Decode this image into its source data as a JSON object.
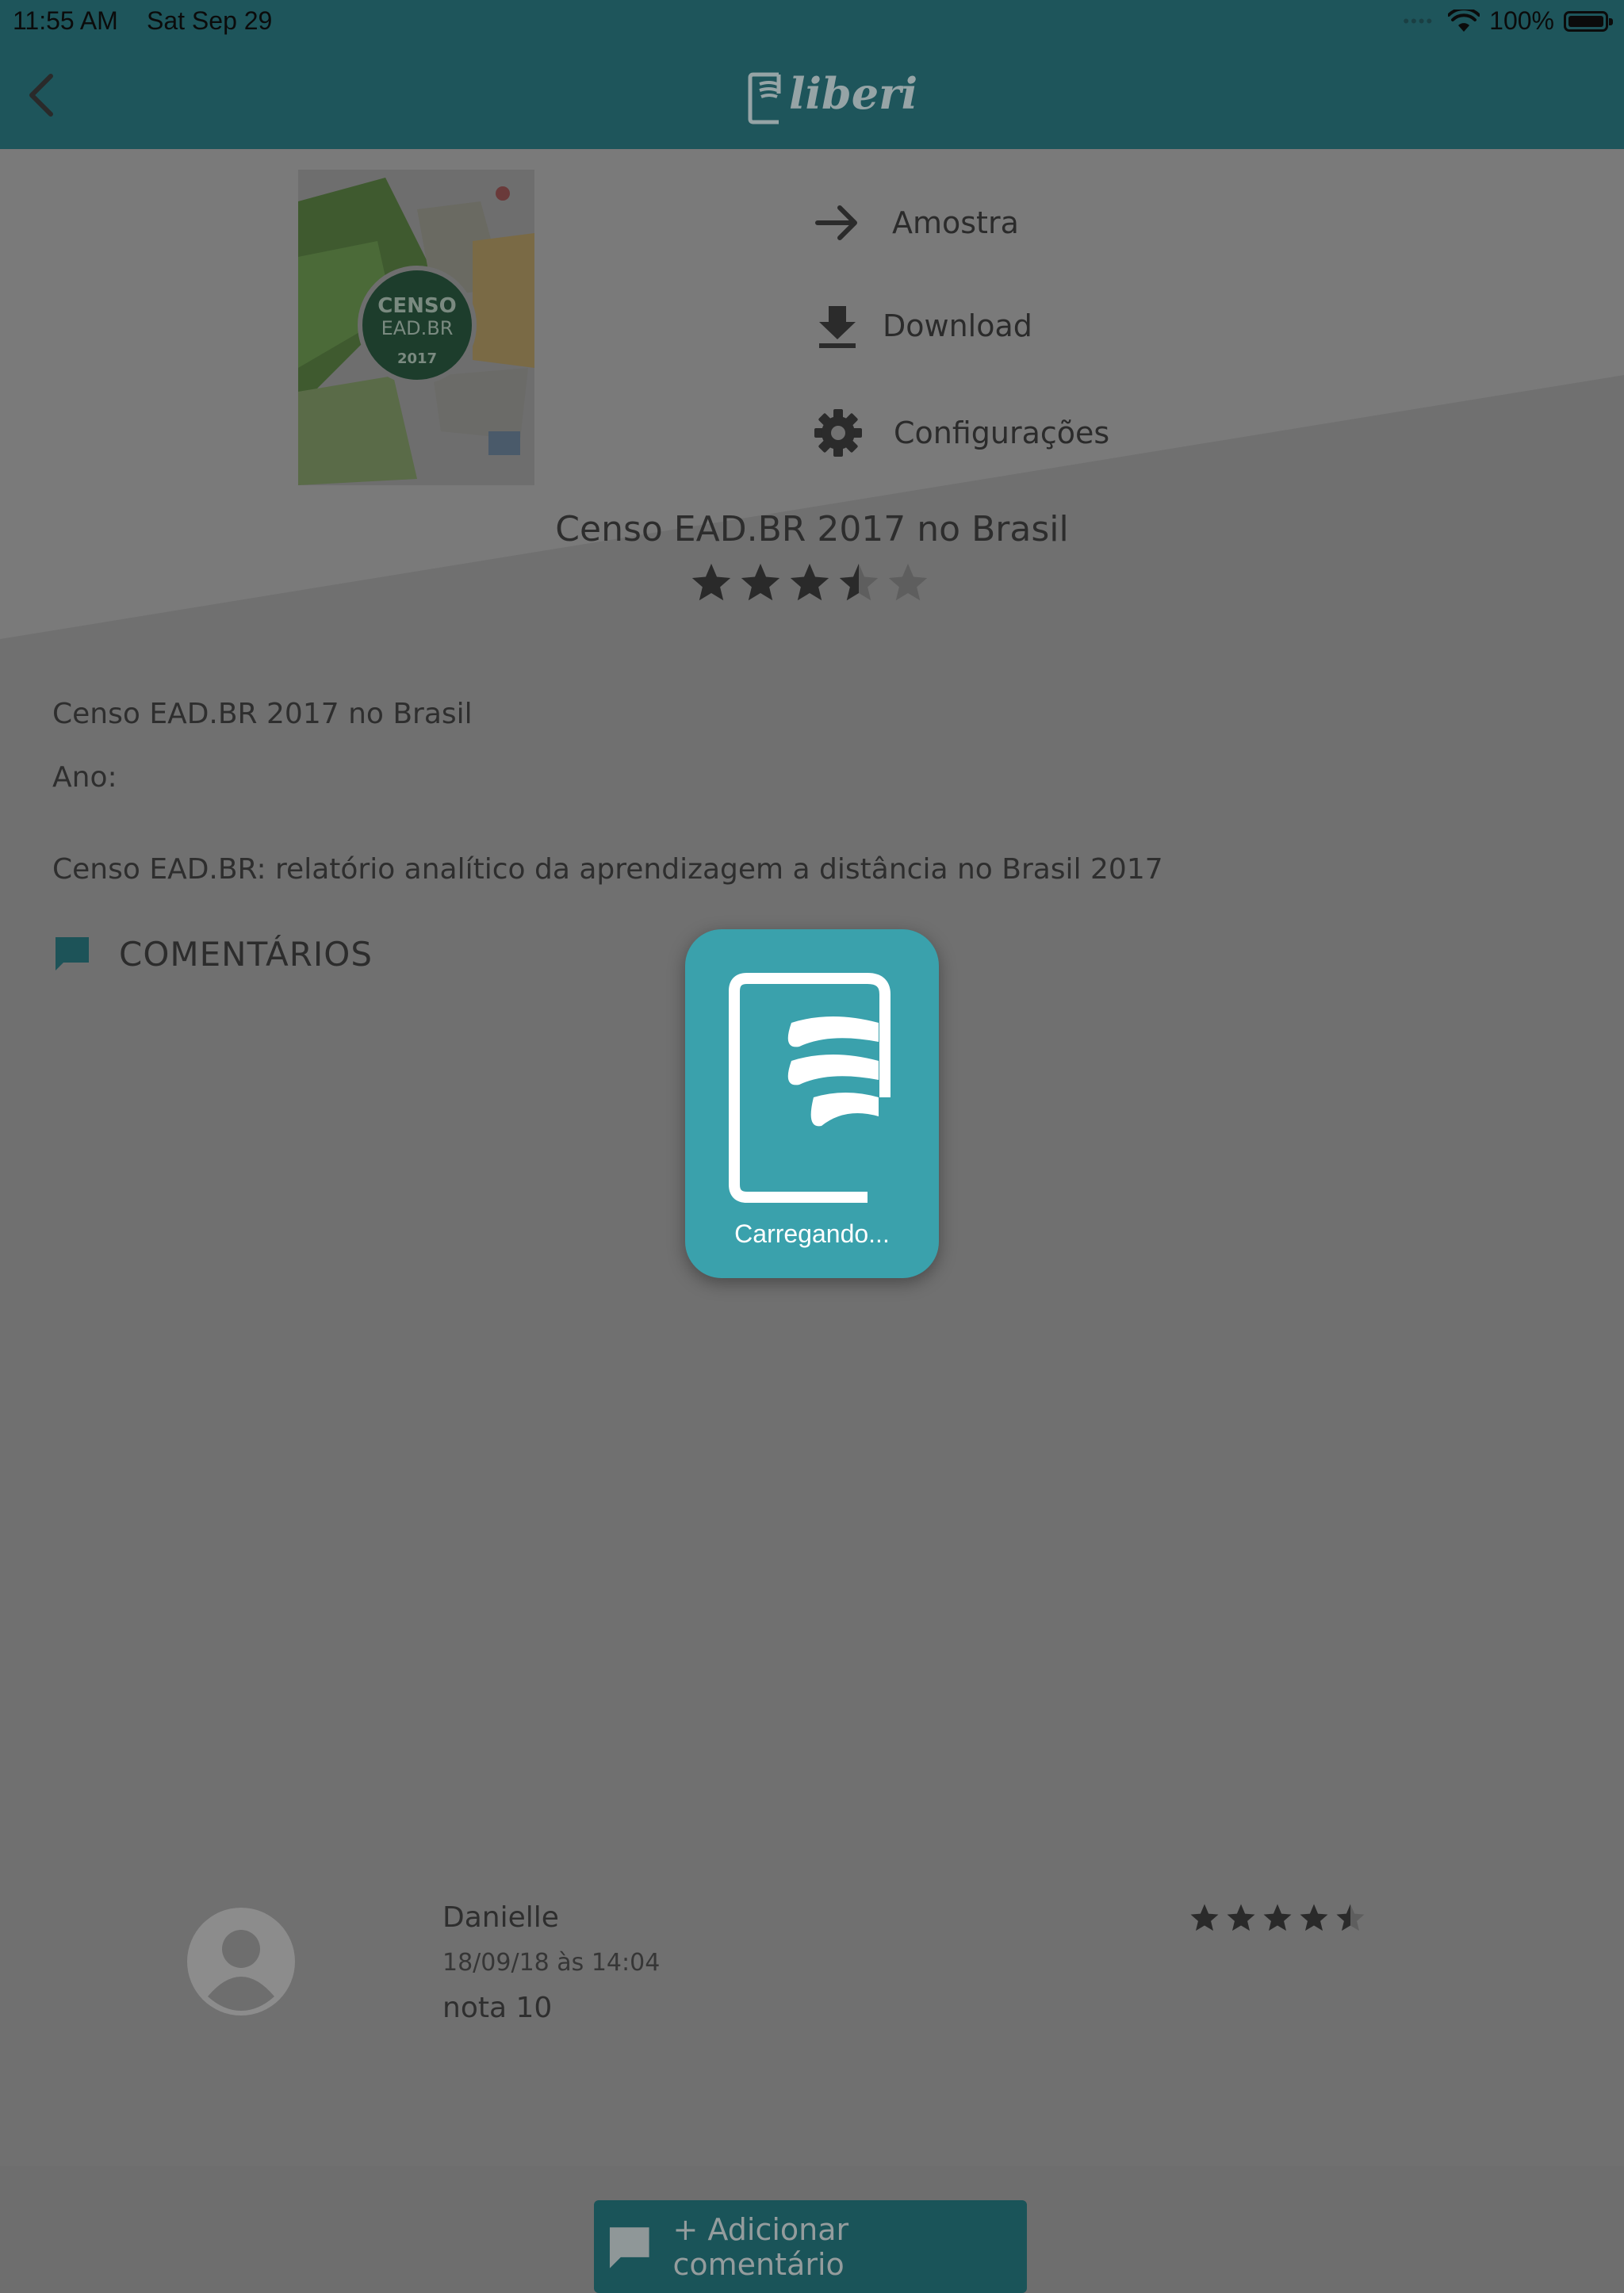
{
  "status_bar": {
    "time": "11:55 AM",
    "date": "Sat Sep 29",
    "battery": "100%"
  },
  "header": {
    "logo_text": "liberi",
    "back_icon": "chevron-left-icon"
  },
  "actions": {
    "sample_label": "Amostra",
    "download_label": "Download",
    "settings_label": "Configurações"
  },
  "book": {
    "title": "Censo EAD.BR 2017 no Brasil",
    "rating": 3.5,
    "rating_max": 5,
    "details_title": "Censo EAD.BR 2017 no Brasil",
    "year_label": "Ano:",
    "description": "Censo EAD.BR: relatório analítico da aprendizagem a distância no Brasil 2017",
    "cover": {
      "line1": "CENSO",
      "line2": "EAD.BR",
      "year": "2017"
    }
  },
  "comments": {
    "heading": "COMENTÁRIOS",
    "items": [
      {
        "author": "Danielle",
        "date": "18/09/18 às 14:04",
        "text": "nota 10",
        "rating": 4.5
      }
    ],
    "add_label": "+ Adicionar comentário"
  },
  "loading": {
    "text": "Carregando..."
  },
  "colors": {
    "header": "#1e555b",
    "overlay_bg": "#707070",
    "loader": "#3aa1ac",
    "accent_button": "#1a5459"
  }
}
